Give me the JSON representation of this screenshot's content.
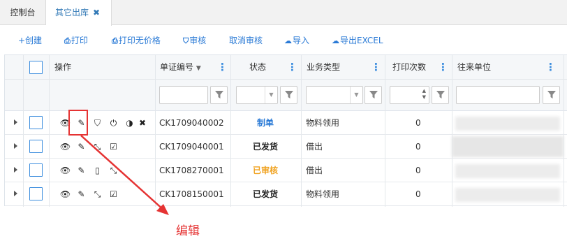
{
  "tabs": [
    {
      "label": "控制台"
    },
    {
      "label": "其它出库",
      "close": "✖"
    }
  ],
  "toolbar": {
    "create": "+创建",
    "print": "打印",
    "print_no_price": "打印无价格",
    "approve": "审核",
    "cancel_approve": "取消审核",
    "import": "导入",
    "export": "导出EXCEL"
  },
  "columns": {
    "ops": "操作",
    "doc_no": "单证编号",
    "status": "状态",
    "biz_type": "业务类型",
    "print_count": "打印次数",
    "partner": "往来单位"
  },
  "rows": [
    {
      "doc_no": "CK1709040002",
      "status": "制单",
      "biz_type": "物料领用",
      "print_count": "0"
    },
    {
      "doc_no": "CK1709040001",
      "status": "已发货",
      "biz_type": "借出",
      "print_count": "0"
    },
    {
      "doc_no": "CK1708270001",
      "status": "已审核",
      "biz_type": "借出",
      "print_count": "0"
    },
    {
      "doc_no": "CK1708150001",
      "status": "已发货",
      "biz_type": "物料领用",
      "print_count": "0"
    }
  ],
  "annotation": "编辑",
  "colors": {
    "accent": "#3c8dde",
    "link": "#2a7ad6",
    "draft": "#2a7ad6",
    "approved": "#f0a21f",
    "annotation_red": "#e53333"
  }
}
